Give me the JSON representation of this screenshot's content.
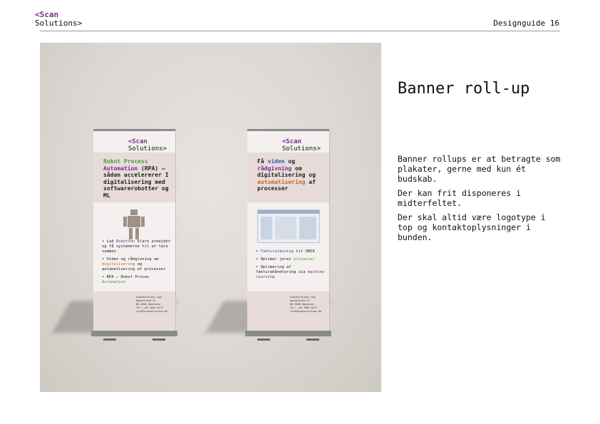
{
  "header": {
    "logo_line1": "<Scan",
    "logo_line2": "Solutions>",
    "page_label": "Designguide 16"
  },
  "banner_left": {
    "logo_line1": "<Scan",
    "logo_line2": "Solutions>",
    "headline_part1": "Robot Process",
    "headline_part2": "Automation",
    "headline_part3": "(RPA) –",
    "headline_part4": "sådan accelererer I",
    "headline_part5": "digitalisering med",
    "headline_part6": "softwarerobotter",
    "headline_part7": "og ML",
    "bullet1_a": "Lad",
    "bullet1_b": "Robotten",
    "bullet1_c": "klare arbejdet og få systemerne til at tale sammen",
    "bullet2_a": "Viden og rådgivning om",
    "bullet2_b": "digitalisering",
    "bullet2_c": "og automatisering af processer",
    "bullet3_a": "RPA – Robot Proces",
    "bullet3_b": "Automation",
    "footer_line1": "ScanSolutions ApS",
    "footer_line2": "Havnefrand 31",
    "footer_line3": "DK-2000 Kbenhaun",
    "footer_line4": "Tel: +45 7020 0171",
    "footer_line5": "info@scansolutions.dk"
  },
  "banner_right": {
    "logo_line1": "<Scan",
    "logo_line2": "Solutions>",
    "headline_part1": "Få",
    "headline_part2": "viden",
    "headline_part3": "og",
    "headline_part4": "rådgivning",
    "headline_part5": "om",
    "headline_part6": "digitalisering",
    "headline_part7": "og",
    "headline_part8": "automatisering",
    "headline_part9": "af processer",
    "bullet1_a": "Fakturalæsning",
    "bullet1_b": "til UNIK",
    "bullet2_a": "Optimer jeres",
    "bullet2_b": "processer",
    "bullet3_a": "Optimering af fakturahåndtering via",
    "bullet3_b": "machine learning",
    "footer_line1": "ScanSolutions ApS",
    "footer_line2": "Havnefrand 31",
    "footer_line3": "DK-2000 Kbenhaun",
    "footer_line4": "Tel: +45 7020 0171",
    "footer_line5": "info@scansolutions.dk"
  },
  "content": {
    "title": "Banner roll-up",
    "paragraph1": "Banner rollups er at betragte som plakater, gerne med kun ét budskab.",
    "paragraph2": "Der kan frit disponeres i midterfeltet.",
    "paragraph3": "Der skal altid være logotype i top og kontaktoplysninger i bunden."
  }
}
